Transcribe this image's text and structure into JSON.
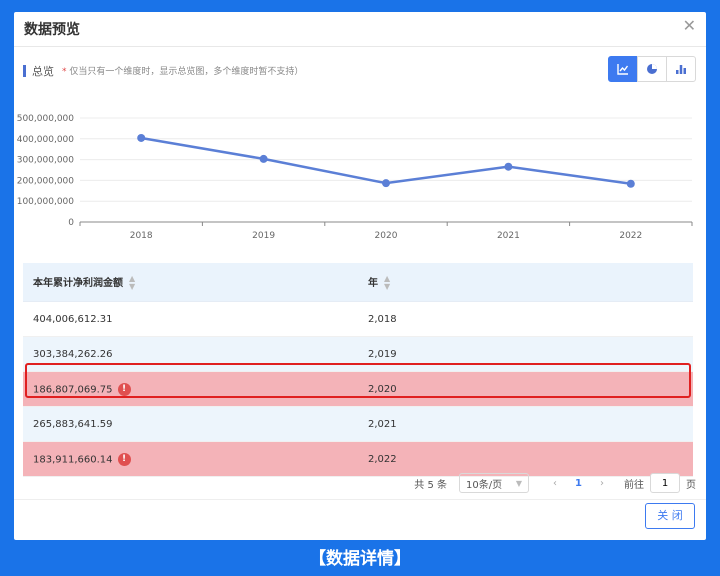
{
  "dialog": {
    "title": "数据预览",
    "close_icon": "close-icon"
  },
  "section": {
    "label": "总览",
    "hint_star": "*",
    "hint": "仅当只有一个维度时，显示总览图，多个维度时暂不支持）"
  },
  "chart_switch": {
    "items": [
      {
        "icon": "line-chart-icon",
        "active": true
      },
      {
        "icon": "pie-chart-icon",
        "active": false
      },
      {
        "icon": "bar-chart-icon",
        "active": false
      }
    ]
  },
  "chart_data": {
    "type": "line",
    "x": [
      "2018",
      "2019",
      "2020",
      "2021",
      "2022"
    ],
    "series": [
      {
        "values": [
          404006612.31,
          303384262.26,
          186807069.75,
          265883641.59,
          183911660.14
        ],
        "color": "#5b7fd6"
      }
    ],
    "yticks": [
      "0",
      "100,000,000",
      "200,000,000",
      "300,000,000",
      "400,000,000",
      "500,000,000"
    ],
    "ylim": [
      0,
      500000000
    ],
    "grid": true
  },
  "table": {
    "headers": [
      "本年累计净利润金额",
      "年"
    ],
    "rows": [
      {
        "amount": "404,006,612.31",
        "year": "2,018",
        "error": false
      },
      {
        "amount": "303,384,262.26",
        "year": "2,019",
        "error": false
      },
      {
        "amount": "186,807,069.75",
        "year": "2,020",
        "error": true
      },
      {
        "amount": "265,883,641.59",
        "year": "2,021",
        "error": false
      },
      {
        "amount": "183,911,660.14",
        "year": "2,022",
        "error": true
      }
    ],
    "warn_glyph": "!"
  },
  "pager": {
    "total": "共 5 条",
    "page_size": "10条/页",
    "prev": "‹",
    "current": "1",
    "next": "›",
    "goto_label": "前往",
    "goto_value": "1",
    "goto_suffix": "页"
  },
  "footer": {
    "close_label": "关 闭"
  },
  "caption": "【数据详情】"
}
